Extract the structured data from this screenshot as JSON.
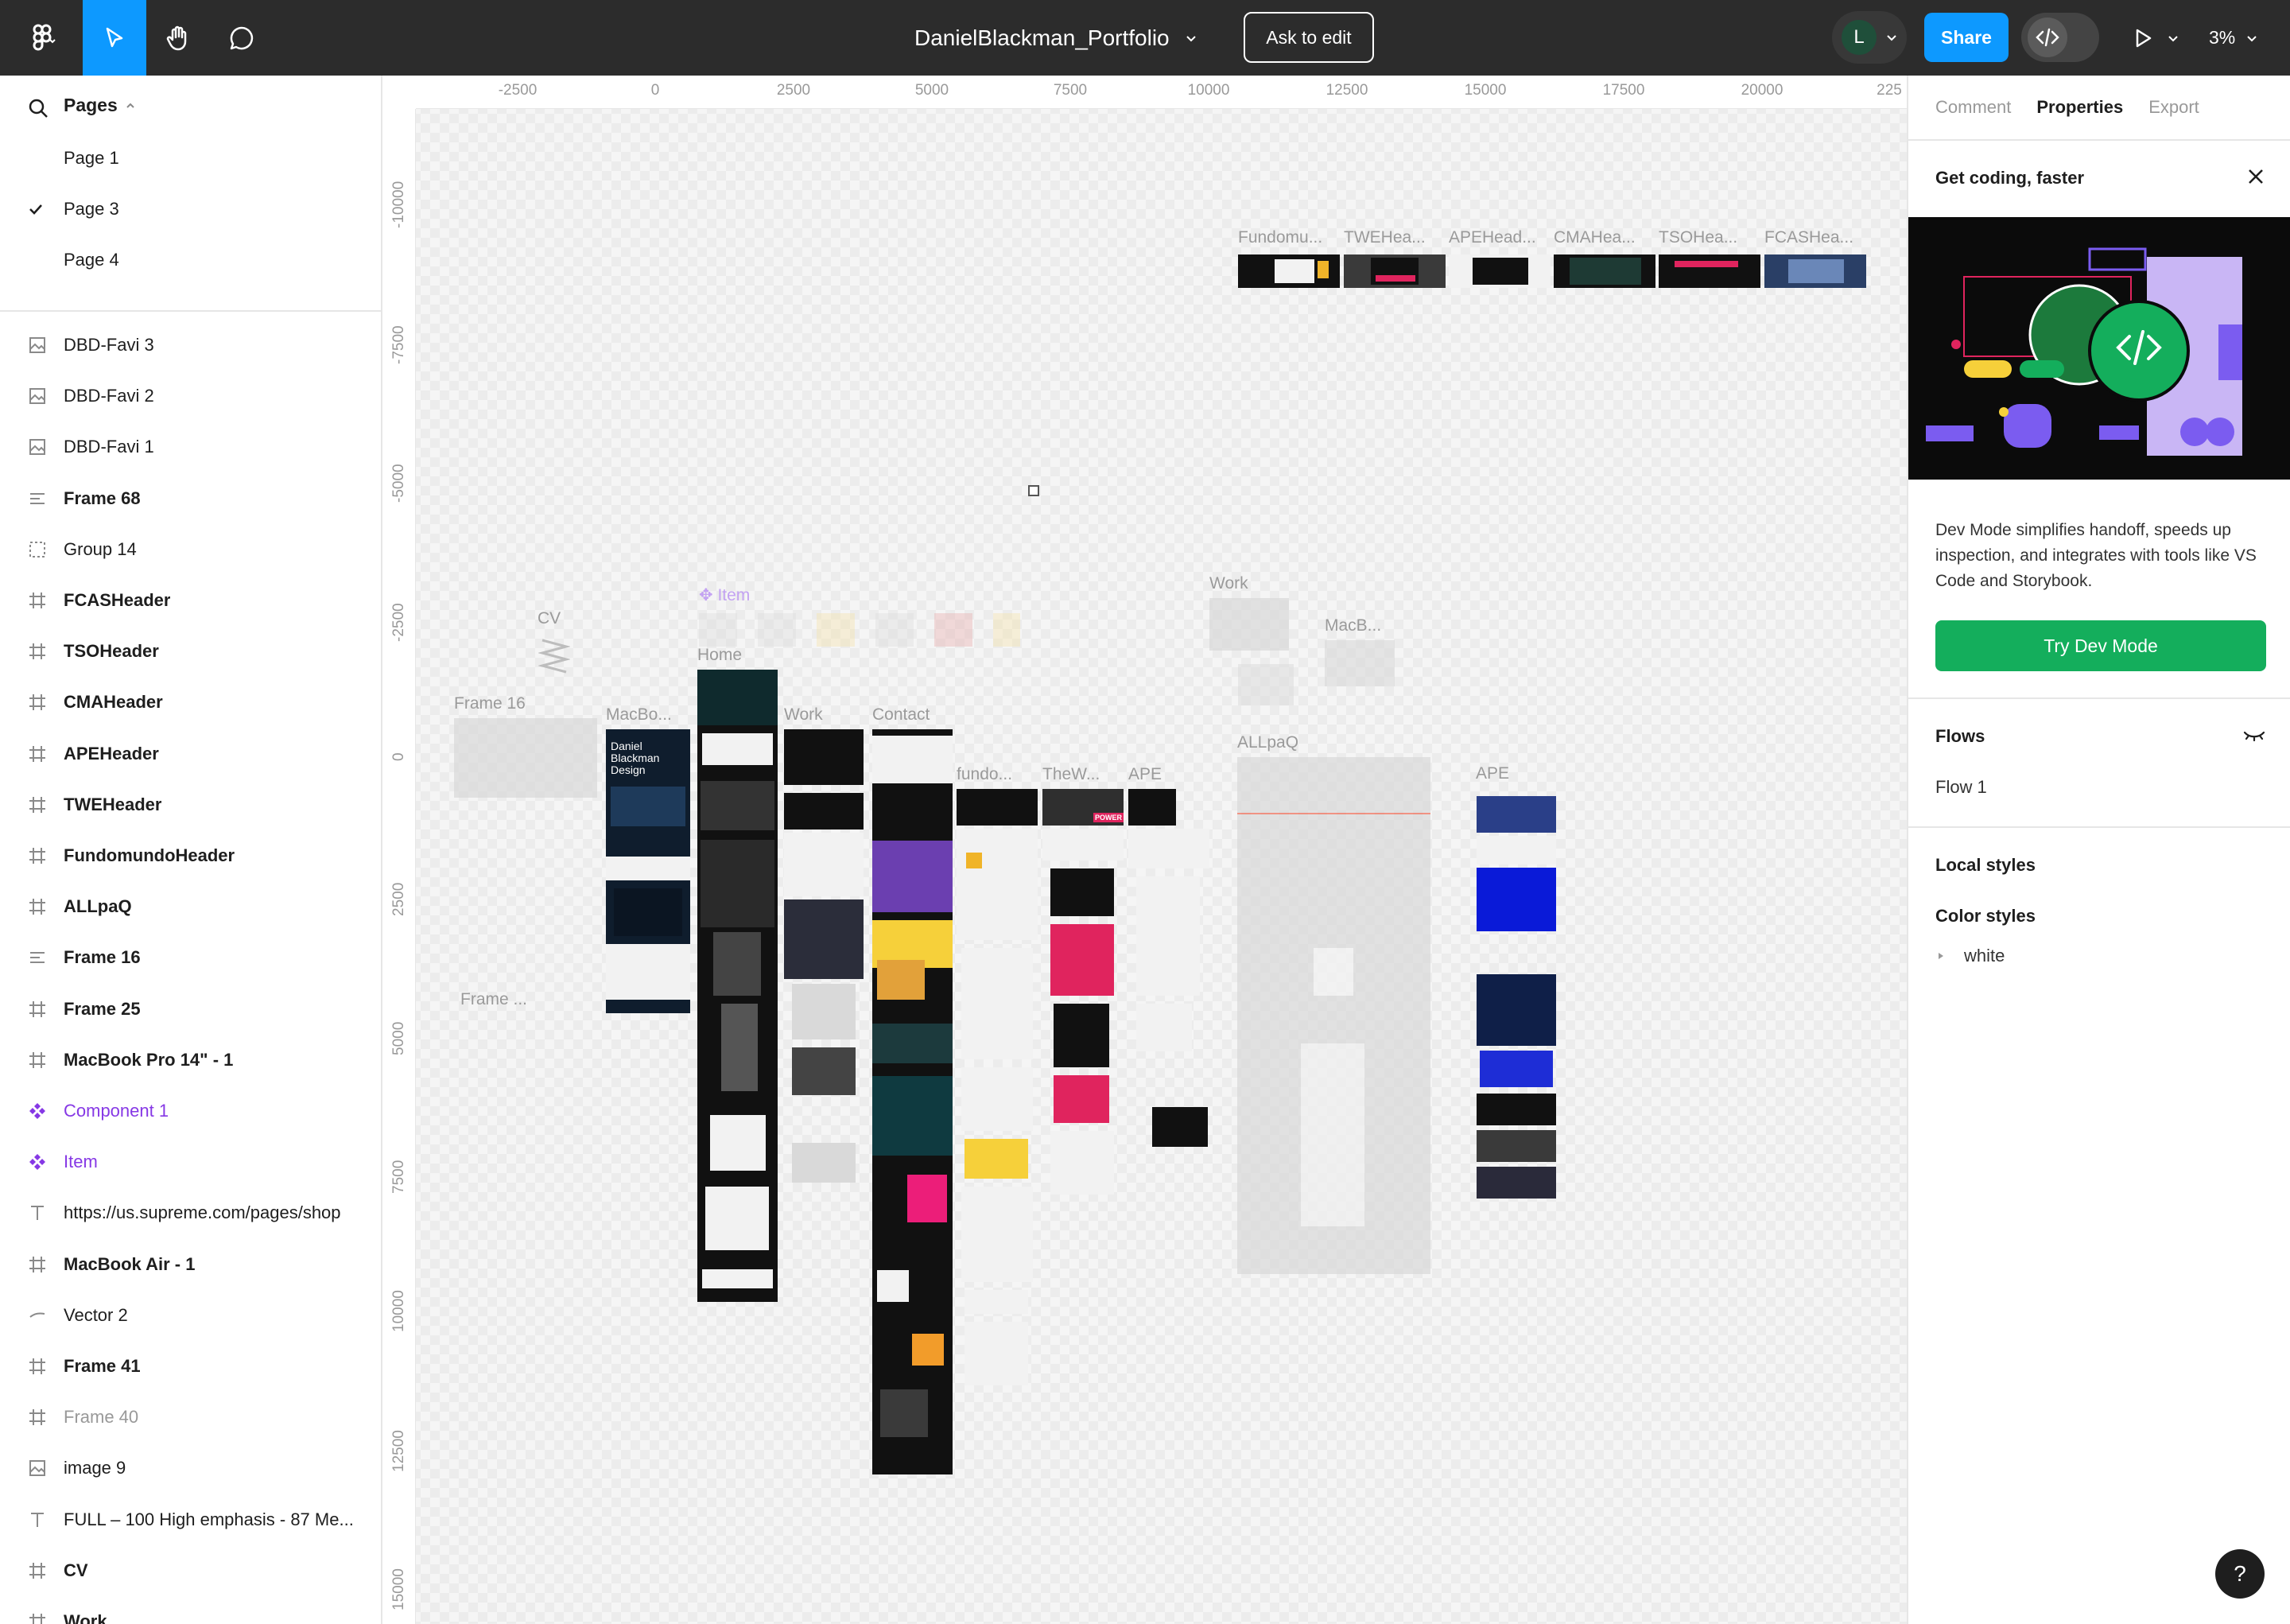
{
  "toolbar": {
    "doc_title": "DanielBlackman_Portfolio",
    "ask_to_edit": "Ask to edit",
    "avatar_initial": "L",
    "share": "Share",
    "zoom": "3%"
  },
  "pages": {
    "header": "Pages",
    "items": [
      {
        "label": "Page 1",
        "selected": false
      },
      {
        "label": "Page 3",
        "selected": true
      },
      {
        "label": "Page 4",
        "selected": false
      }
    ]
  },
  "layers": [
    {
      "label": "DBD-Favi 3",
      "icon": "image-icon",
      "style": "normal"
    },
    {
      "label": "DBD-Favi 2",
      "icon": "image-icon",
      "style": "normal"
    },
    {
      "label": "DBD-Favi 1",
      "icon": "image-icon",
      "style": "normal"
    },
    {
      "label": "Frame 68",
      "icon": "autolayout-icon",
      "style": "bold"
    },
    {
      "label": "Group 14",
      "icon": "group-icon",
      "style": "normal"
    },
    {
      "label": "FCASHeader",
      "icon": "frame-icon",
      "style": "bold"
    },
    {
      "label": "TSOHeader",
      "icon": "frame-icon",
      "style": "bold"
    },
    {
      "label": "CMAHeader",
      "icon": "frame-icon",
      "style": "bold"
    },
    {
      "label": "APEHeader",
      "icon": "frame-icon",
      "style": "bold"
    },
    {
      "label": "TWEHeader",
      "icon": "frame-icon",
      "style": "bold"
    },
    {
      "label": "FundomundoHeader",
      "icon": "frame-icon",
      "style": "bold"
    },
    {
      "label": "ALLpaQ",
      "icon": "frame-icon",
      "style": "bold"
    },
    {
      "label": "Frame 16",
      "icon": "autolayout-icon",
      "style": "bold"
    },
    {
      "label": "Frame 25",
      "icon": "frame-icon",
      "style": "bold"
    },
    {
      "label": "MacBook Pro 14\" - 1",
      "icon": "frame-icon",
      "style": "bold"
    },
    {
      "label": "Component 1",
      "icon": "component-icon",
      "style": "purple"
    },
    {
      "label": "Item",
      "icon": "component-icon",
      "style": "purple"
    },
    {
      "label": "https://us.supreme.com/pages/shop",
      "icon": "text-icon",
      "style": "normal"
    },
    {
      "label": "MacBook Air - 1",
      "icon": "frame-icon",
      "style": "bold"
    },
    {
      "label": "Vector 2",
      "icon": "vector-icon",
      "style": "normal"
    },
    {
      "label": "Frame 41",
      "icon": "frame-icon",
      "style": "bold"
    },
    {
      "label": "Frame 40",
      "icon": "frame-icon",
      "style": "dim"
    },
    {
      "label": "image 9",
      "icon": "image-icon",
      "style": "normal"
    },
    {
      "label": "FULL – 100 High emphasis - 87 Me...",
      "icon": "text-icon",
      "style": "normal"
    },
    {
      "label": "CV",
      "icon": "frame-icon",
      "style": "bold"
    },
    {
      "label": "Work",
      "icon": "frame-icon",
      "style": "bold"
    }
  ],
  "ruler": {
    "top": [
      "-2500",
      "0",
      "2500",
      "5000",
      "7500",
      "10000",
      "12500",
      "15000",
      "17500",
      "20000",
      "225"
    ],
    "left": [
      "-10000",
      "-7500",
      "-5000",
      "-2500",
      "0",
      "2500",
      "5000",
      "7500",
      "10000",
      "12500",
      "15000"
    ]
  },
  "canvas_labels": {
    "header_frames": [
      "Fundomu...",
      "TWEHea...",
      "APEHead...",
      "CMAHea...",
      "TSOHea...",
      "FCASHea..."
    ],
    "item": "Item",
    "cv": "CV",
    "home": "Home",
    "work": "Work",
    "work_top": "Work",
    "contact": "Contact",
    "frame16": "Frame 16",
    "macbo": "MacBo...",
    "macb": "MacB...",
    "fundo": "fundo...",
    "thew": "TheW...",
    "ape1": "APE",
    "allpaq": "ALLpaQ",
    "ape2": "APE",
    "frame_dots": "Frame ...",
    "macbook_title": "Daniel Blackman Design",
    "power_tag": "POWER"
  },
  "right_panel": {
    "tabs": [
      {
        "label": "Comment",
        "active": false
      },
      {
        "label": "Properties",
        "active": true
      },
      {
        "label": "Export",
        "active": false
      }
    ],
    "promo_title": "Get coding, faster",
    "promo_text": "Dev Mode simplifies handoff, speeds up inspection, and integrates with tools like VS Code and Storybook.",
    "try_button": "Try Dev Mode",
    "flows_title": "Flows",
    "flow_item": "Flow 1",
    "local_styles": "Local styles",
    "color_styles": "Color styles",
    "color_item": "white"
  },
  "help": "?",
  "colors": {
    "toolbar_bg": "#2c2c2c",
    "accent_blue": "#0d99ff",
    "dev_green": "#14ae5c",
    "component_purple": "#8638e5"
  }
}
